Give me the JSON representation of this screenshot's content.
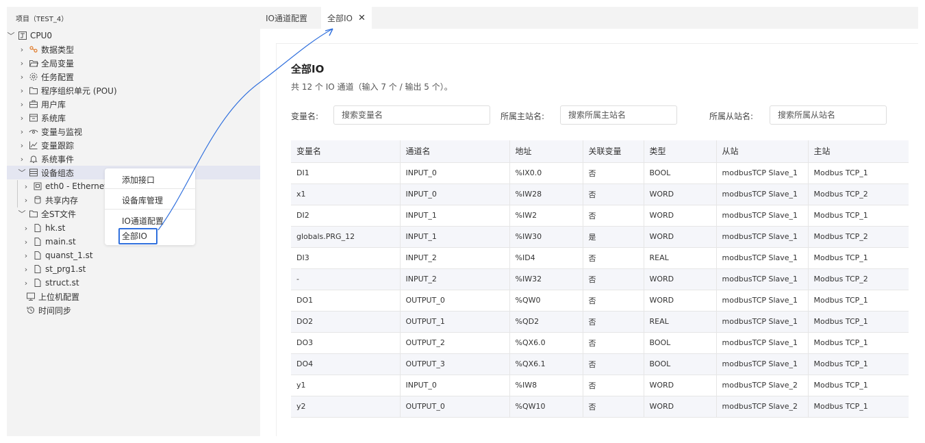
{
  "sidebar": {
    "project_title": "项目（TEST_4）",
    "items": [
      {
        "label": "CPU0",
        "chevron": "﹀",
        "icon": "cpu-icon"
      },
      {
        "label": "数据类型",
        "chevron": "›",
        "icon": "data-type-icon"
      },
      {
        "label": "全局变量",
        "chevron": "›",
        "icon": "folder-open-icon"
      },
      {
        "label": "任务配置",
        "chevron": "›",
        "icon": "gear-icon"
      },
      {
        "label": "程序组织单元 (POU)",
        "chevron": "›",
        "icon": "folder-icon"
      },
      {
        "label": "用户库",
        "chevron": "›",
        "icon": "library-icon"
      },
      {
        "label": "系统库",
        "chevron": "›",
        "icon": "system-library-icon"
      },
      {
        "label": "变量与监视",
        "chevron": "›",
        "icon": "eye-icon"
      },
      {
        "label": "变量跟踪",
        "chevron": "›",
        "icon": "trend-icon"
      },
      {
        "label": "系统事件",
        "chevron": "›",
        "icon": "bell-icon"
      },
      {
        "label": "设备组态",
        "chevron": "﹀",
        "icon": "device-config-icon"
      },
      {
        "label": "eth0 - Ethernet(T",
        "chevron": "›",
        "icon": "ethernet-icon"
      },
      {
        "label": "共享内存",
        "chevron": "›",
        "icon": "database-icon"
      },
      {
        "label": "全ST文件",
        "chevron": "﹀",
        "icon": "folder-icon"
      },
      {
        "label": "hk.st",
        "chevron": "›",
        "icon": "file-icon"
      },
      {
        "label": "main.st",
        "chevron": "›",
        "icon": "file-icon"
      },
      {
        "label": "quanst_1.st",
        "chevron": "›",
        "icon": "file-icon"
      },
      {
        "label": "st_prg1.st",
        "chevron": "›",
        "icon": "file-icon"
      },
      {
        "label": "struct.st",
        "chevron": "›",
        "icon": "file-icon"
      },
      {
        "label": "上位机配置",
        "chevron": "",
        "icon": "monitor-icon"
      },
      {
        "label": "时间同步",
        "chevron": "",
        "icon": "history-icon"
      }
    ]
  },
  "context_menu": {
    "items": [
      {
        "label": "添加接口"
      },
      {
        "label": "设备库管理"
      },
      {
        "label": "IO通道配置"
      },
      {
        "label": "全部IO"
      }
    ]
  },
  "tabs": [
    {
      "label": "IO通道配置"
    },
    {
      "label": "全部IO",
      "close": "✕"
    }
  ],
  "main": {
    "title": "全部IO",
    "subtitle": "共 12 个 IO 通道（输入 7 个 / 输出 5 个）。",
    "filters": [
      {
        "label": "变量名:",
        "placeholder": "搜索变量名"
      },
      {
        "label": "所属主站名:",
        "placeholder": "搜索所属主站名"
      },
      {
        "label": "所属从站名:",
        "placeholder": "搜索所属从站名"
      }
    ],
    "table": {
      "headers": [
        "变量名",
        "通道名",
        "地址",
        "关联变量",
        "类型",
        "从站",
        "主站"
      ],
      "rows": [
        [
          "DI1",
          "INPUT_0",
          "%IX0.0",
          "否",
          "BOOL",
          "modbusTCP Slave_1",
          "Modbus TCP_1"
        ],
        [
          "x1",
          "INPUT_0",
          "%IW28",
          "否",
          "WORD",
          "modbusTCP Slave_1",
          "Modbus TCP_2"
        ],
        [
          "DI2",
          "INPUT_1",
          "%IW2",
          "否",
          "WORD",
          "modbusTCP Slave_1",
          "Modbus TCP_1"
        ],
        [
          "globals.PRG_12",
          "INPUT_1",
          "%IW30",
          "是",
          "WORD",
          "modbusTCP Slave_1",
          "Modbus TCP_2"
        ],
        [
          "DI3",
          "INPUT_2",
          "%ID4",
          "否",
          "REAL",
          "modbusTCP Slave_1",
          "Modbus TCP_1"
        ],
        [
          "-",
          "INPUT_2",
          "%IW32",
          "否",
          "WORD",
          "modbusTCP Slave_1",
          "Modbus TCP_2"
        ],
        [
          "DO1",
          "OUTPUT_0",
          "%QW0",
          "否",
          "WORD",
          "modbusTCP Slave_1",
          "Modbus TCP_1"
        ],
        [
          "DO2",
          "OUTPUT_1",
          "%QD2",
          "否",
          "REAL",
          "modbusTCP Slave_1",
          "Modbus TCP_1"
        ],
        [
          "DO3",
          "OUTPUT_2",
          "%QX6.0",
          "否",
          "BOOL",
          "modbusTCP Slave_1",
          "Modbus TCP_1"
        ],
        [
          "DO4",
          "OUTPUT_3",
          "%QX6.1",
          "否",
          "BOOL",
          "modbusTCP Slave_1",
          "Modbus TCP_1"
        ],
        [
          "y1",
          "INPUT_0",
          "%IW8",
          "否",
          "WORD",
          "modbusTCP Slave_2",
          "Modbus TCP_1"
        ],
        [
          "y2",
          "OUTPUT_0",
          "%QW10",
          "否",
          "WORD",
          "modbusTCP Slave_2",
          "Modbus TCP_1"
        ]
      ]
    }
  },
  "colors": {
    "sidebar_bg": "#f3f3f3",
    "selected_row": "#e4e6f1",
    "accent": "#2f6fdd",
    "table_header_bg": "#f5f6fa",
    "orange_icon": "#e07b2a"
  }
}
